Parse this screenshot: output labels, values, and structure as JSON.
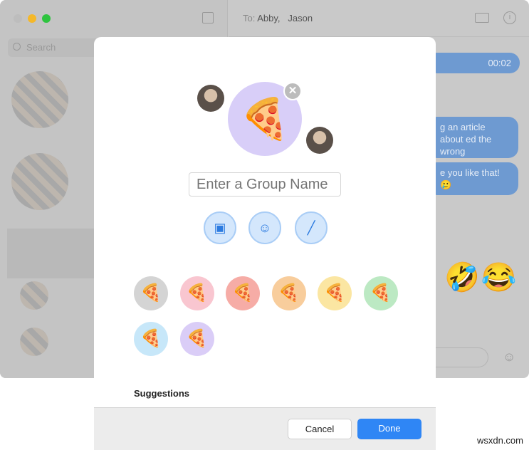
{
  "window": {
    "search_placeholder": "Search",
    "to_label": "To:",
    "recipients": [
      "Abby,",
      "Jason"
    ],
    "messages": [
      "00:02",
      "g an article about ed the wrong",
      "e you like that! 🥲"
    ],
    "big_emojis": "🤣😂",
    "traffic_colors": [
      "#bdbdbd",
      "#f5b829",
      "#2ec43f"
    ]
  },
  "modal": {
    "avatar_emoji": "🍕",
    "avatar_color": "#d8cef8",
    "close_icon": "✕",
    "name_placeholder": "Enter a Group Name",
    "tools": [
      {
        "name": "photos",
        "glyph": "▣"
      },
      {
        "name": "emoji",
        "glyph": "☺"
      },
      {
        "name": "edit",
        "glyph": "╱"
      }
    ],
    "swatches": [
      {
        "color": "#d4d4d4",
        "emoji": "🍕"
      },
      {
        "color": "#f9c6d0",
        "emoji": "🍕"
      },
      {
        "color": "#f6aca6",
        "emoji": "🍕"
      },
      {
        "color": "#f8cd9c",
        "emoji": "🍕"
      },
      {
        "color": "#fbe6a2",
        "emoji": "🍕"
      },
      {
        "color": "#bce9c3",
        "emoji": "🍕"
      },
      {
        "color": "#c7e7f9",
        "emoji": "🍕"
      },
      {
        "color": "#dacdf7",
        "emoji": "🍕"
      }
    ],
    "suggestions_label": "Suggestions",
    "cancel_label": "Cancel",
    "done_label": "Done"
  },
  "watermark": "wsxdn.com"
}
